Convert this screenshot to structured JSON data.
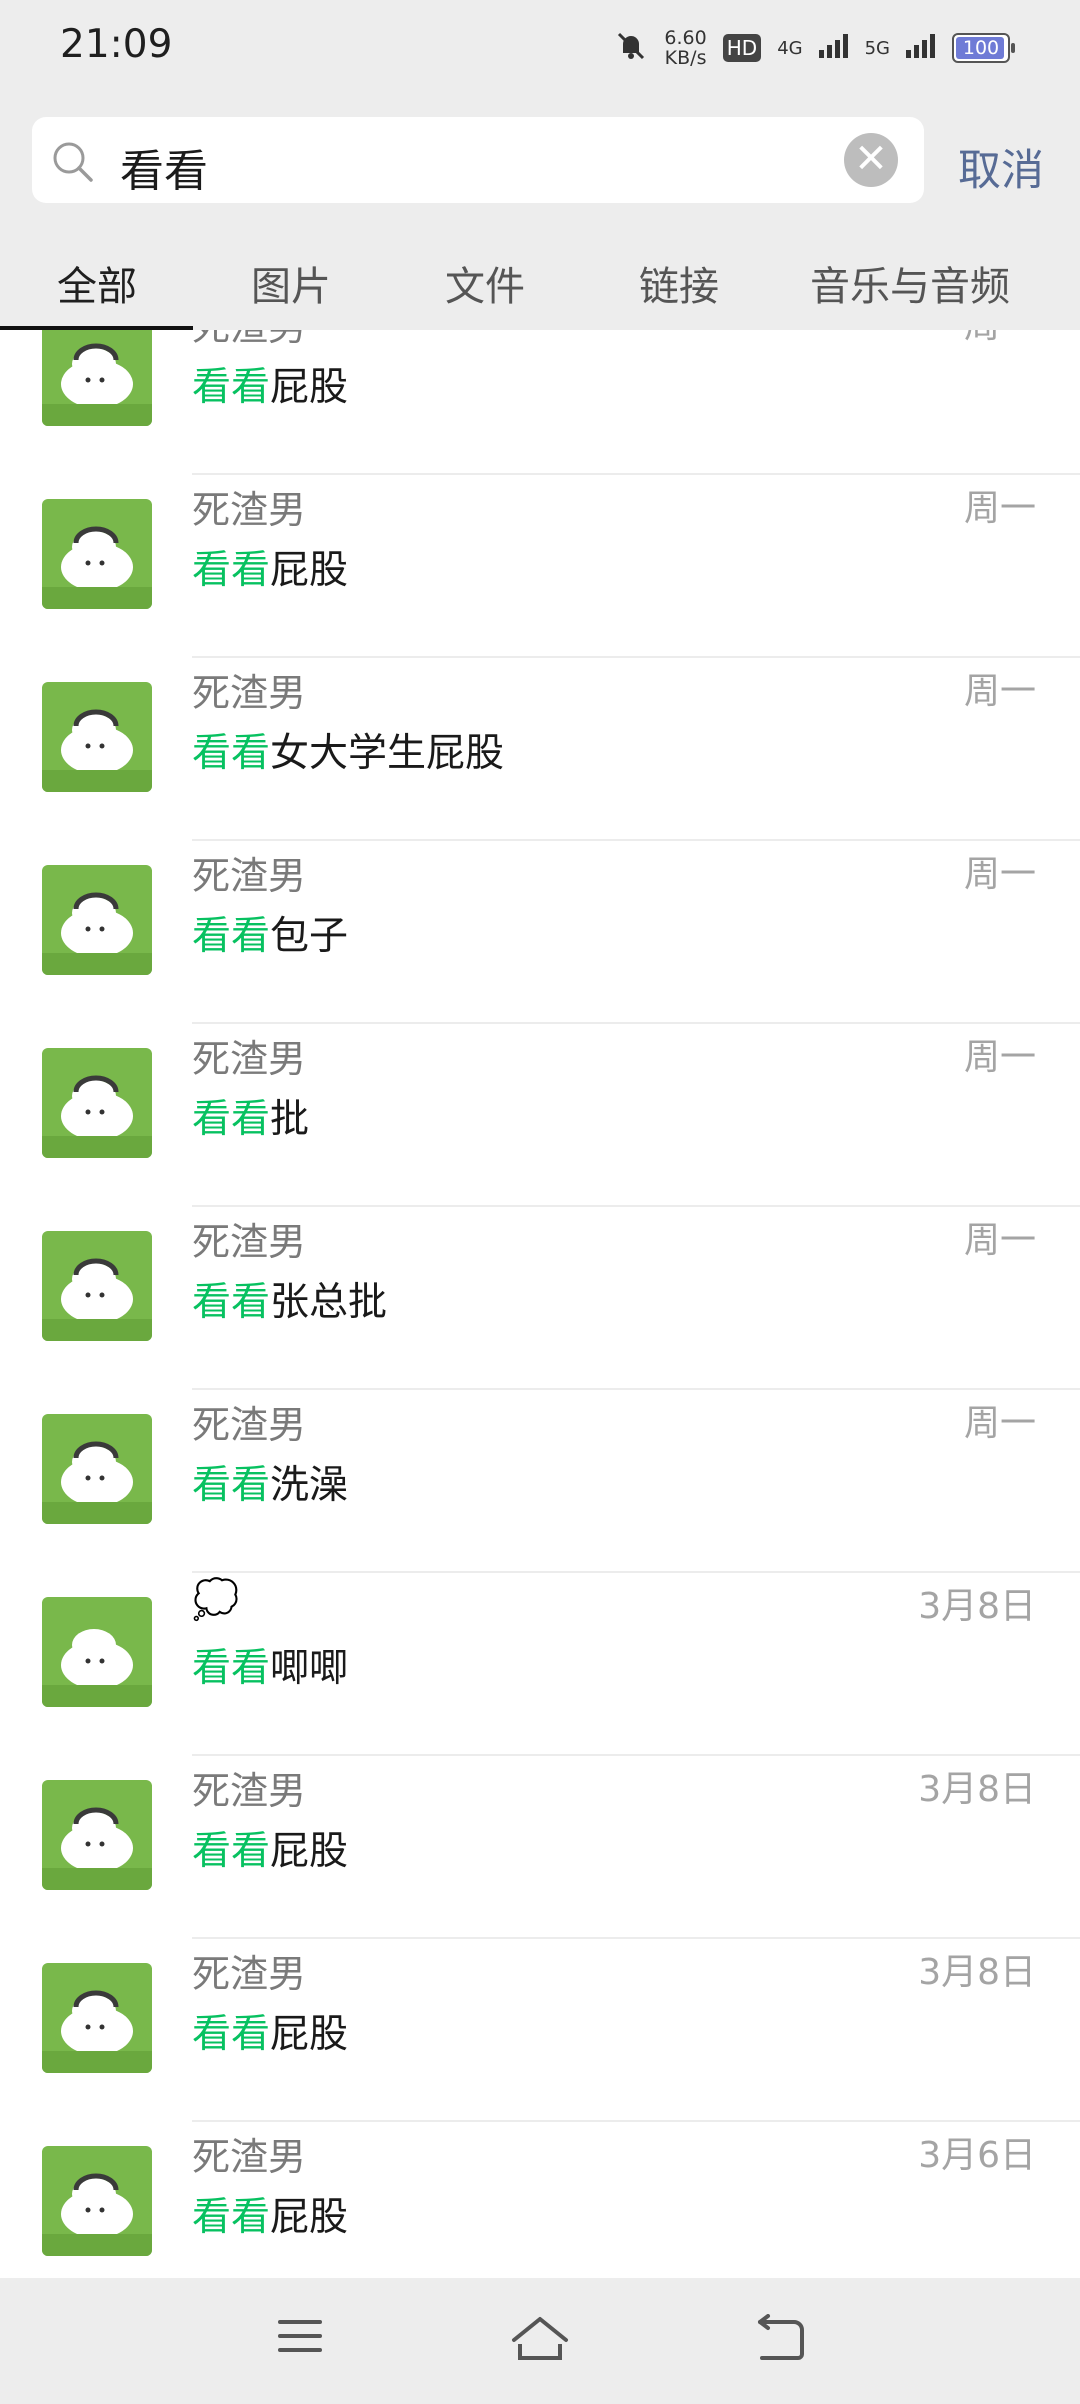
{
  "status_bar": {
    "time": "21:09",
    "net_speed_value": "6.60",
    "net_speed_unit": "KB/s",
    "hd_label": "HD",
    "signal_1": "4G",
    "signal_2": "5G",
    "battery_level": "100"
  },
  "search": {
    "query": "看看",
    "cancel_label": "取消"
  },
  "tabs": [
    {
      "label": "全部",
      "active": true
    },
    {
      "label": "图片",
      "active": false
    },
    {
      "label": "文件",
      "active": false
    },
    {
      "label": "链接",
      "active": false
    },
    {
      "label": "音乐与音频",
      "active": false
    }
  ],
  "results": [
    {
      "name": "死渣男",
      "date": "周一",
      "highlight": "看看",
      "rest": "屁股"
    },
    {
      "name": "死渣男",
      "date": "周一",
      "highlight": "看看",
      "rest": "屁股"
    },
    {
      "name": "死渣男",
      "date": "周一",
      "highlight": "看看",
      "rest": "女大学生屁股"
    },
    {
      "name": "死渣男",
      "date": "周一",
      "highlight": "看看",
      "rest": "包子"
    },
    {
      "name": "死渣男",
      "date": "周一",
      "highlight": "看看",
      "rest": "批"
    },
    {
      "name": "死渣男",
      "date": "周一",
      "highlight": "看看",
      "rest": "张总批"
    },
    {
      "name": "死渣男",
      "date": "周一",
      "highlight": "看看",
      "rest": "洗澡"
    },
    {
      "name": "💭",
      "date": "3月8日",
      "highlight": "看看",
      "rest": "唧唧"
    },
    {
      "name": "死渣男",
      "date": "3月8日",
      "highlight": "看看",
      "rest": "屁股"
    },
    {
      "name": "死渣男",
      "date": "3月8日",
      "highlight": "看看",
      "rest": "屁股"
    },
    {
      "name": "死渣男",
      "date": "3月6日",
      "highlight": "看看",
      "rest": "屁股"
    }
  ],
  "colors": {
    "highlight": "#07c160",
    "link": "#576b95",
    "avatar_bg": "#79b84b"
  },
  "icons": {
    "nav_menu": "menu-icon",
    "nav_home": "home-icon",
    "nav_back": "back-icon"
  }
}
